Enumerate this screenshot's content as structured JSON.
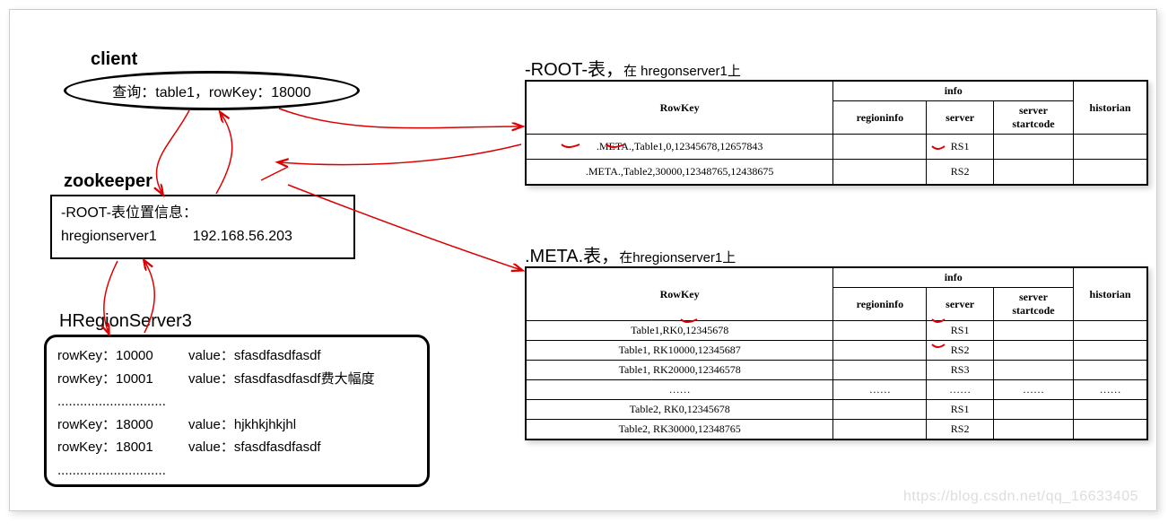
{
  "client": {
    "title": "client",
    "query": "查询：table1，rowKey：18000"
  },
  "zookeeper": {
    "title": "zookeeper",
    "line1": "-ROOT-表位置信息：",
    "host": "hregionserver1",
    "ip": "192.168.56.203"
  },
  "hregionserver": {
    "title": "HRegionServer3",
    "rows": [
      {
        "k": "rowKey：10000",
        "v": "value：sfasdfasdfasdf"
      },
      {
        "k": "rowKey：10001",
        "v": "value：sfasdfasdfasdf费大幅度"
      },
      {
        "k": ".............................",
        "v": ""
      },
      {
        "k": "rowKey：18000",
        "v": "value：hjkhkjhkjhl"
      },
      {
        "k": "rowKey：18001",
        "v": "value：sfasdfasdfasdf"
      },
      {
        "k": ".............................",
        "v": ""
      }
    ]
  },
  "root_table": {
    "title_prefix": "-ROOT-表，",
    "title_sub": "在 hregonserver1上",
    "headers": {
      "rowkey": "RowKey",
      "info": "info",
      "regioninfo": "regioninfo",
      "server": "server",
      "startcode": "server startcode",
      "historian": "historian"
    },
    "rows": [
      {
        "rowkey": ".META.,Table1,0,12345678,12657843",
        "regioninfo": "",
        "server": "RS1",
        "startcode": "",
        "historian": ""
      },
      {
        "rowkey": ".META.,Table2,30000,12348765,12438675",
        "regioninfo": "",
        "server": "RS2",
        "startcode": "",
        "historian": ""
      }
    ]
  },
  "meta_table": {
    "title_prefix": ".META.表，",
    "title_sub": "在hregionserver1上",
    "headers": {
      "rowkey": "RowKey",
      "info": "info",
      "regioninfo": "regioninfo",
      "server": "server",
      "startcode": "server startcode",
      "historian": "historian"
    },
    "rows": [
      {
        "rowkey": "Table1,RK0,12345678",
        "regioninfo": "",
        "server": "RS1",
        "startcode": "",
        "historian": ""
      },
      {
        "rowkey": "Table1, RK10000,12345687",
        "regioninfo": "",
        "server": "RS2",
        "startcode": "",
        "historian": ""
      },
      {
        "rowkey": "Table1, RK20000,12346578",
        "regioninfo": "",
        "server": "RS3",
        "startcode": "",
        "historian": ""
      },
      {
        "rowkey": "……",
        "regioninfo": "……",
        "server": "……",
        "startcode": "……",
        "historian": "……"
      },
      {
        "rowkey": "Table2, RK0,12345678",
        "regioninfo": "",
        "server": "RS1",
        "startcode": "",
        "historian": ""
      },
      {
        "rowkey": "Table2, RK30000,12348765",
        "regioninfo": "",
        "server": "RS2",
        "startcode": "",
        "historian": ""
      }
    ]
  },
  "watermark": "https://blog.csdn.net/qq_16633405"
}
